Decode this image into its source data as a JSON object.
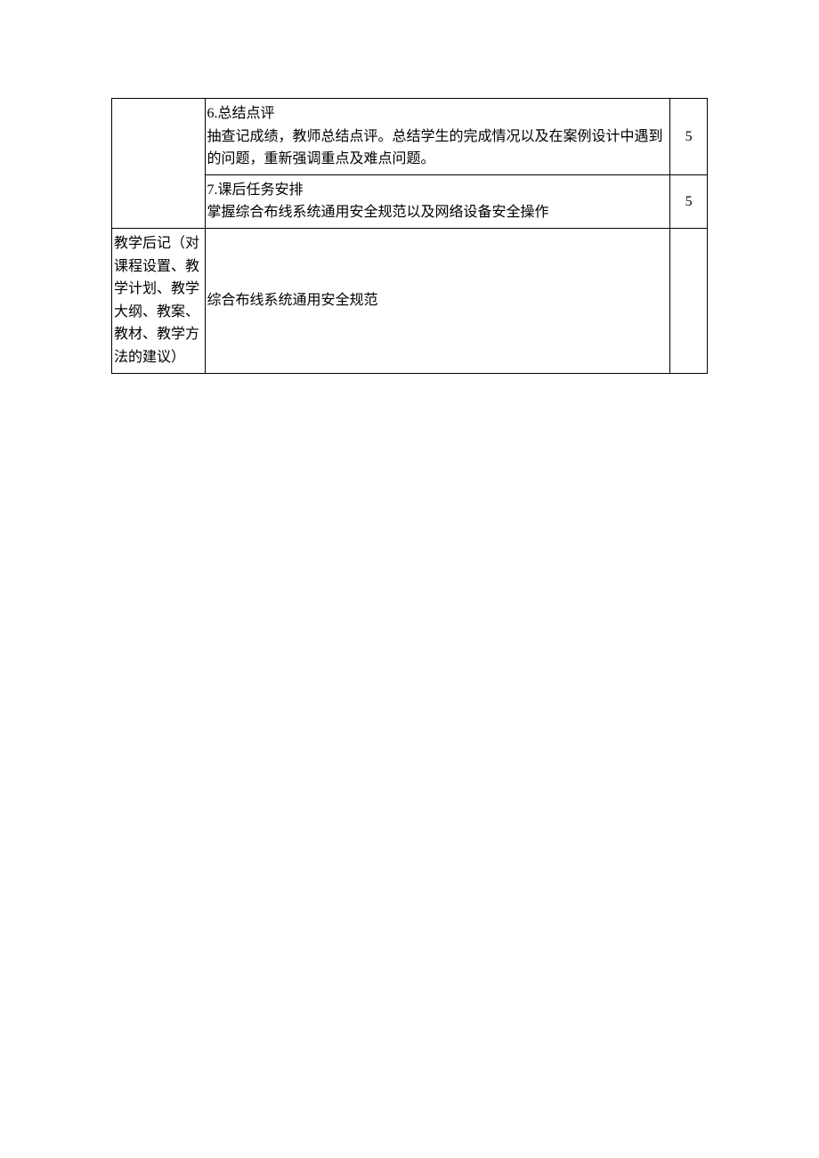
{
  "table": {
    "rows": [
      {
        "col1": "",
        "col2": "6.总结点评\n抽查记成绩，教师总结点评。总结学生的完成情况以及在案例设计中遇到的问题，重新强调重点及难点问题。",
        "col3": "5"
      },
      {
        "col1": "",
        "col2": "7.课后任务安排\n掌握综合布线系统通用安全规范以及网络设备安全操作",
        "col3": "5"
      },
      {
        "col1": "教学后记（对课程设置、教学计划、教学大纲、教案、教材、教学方法的建议）",
        "col2": "综合布线系统通用安全规范",
        "col3": ""
      }
    ]
  }
}
